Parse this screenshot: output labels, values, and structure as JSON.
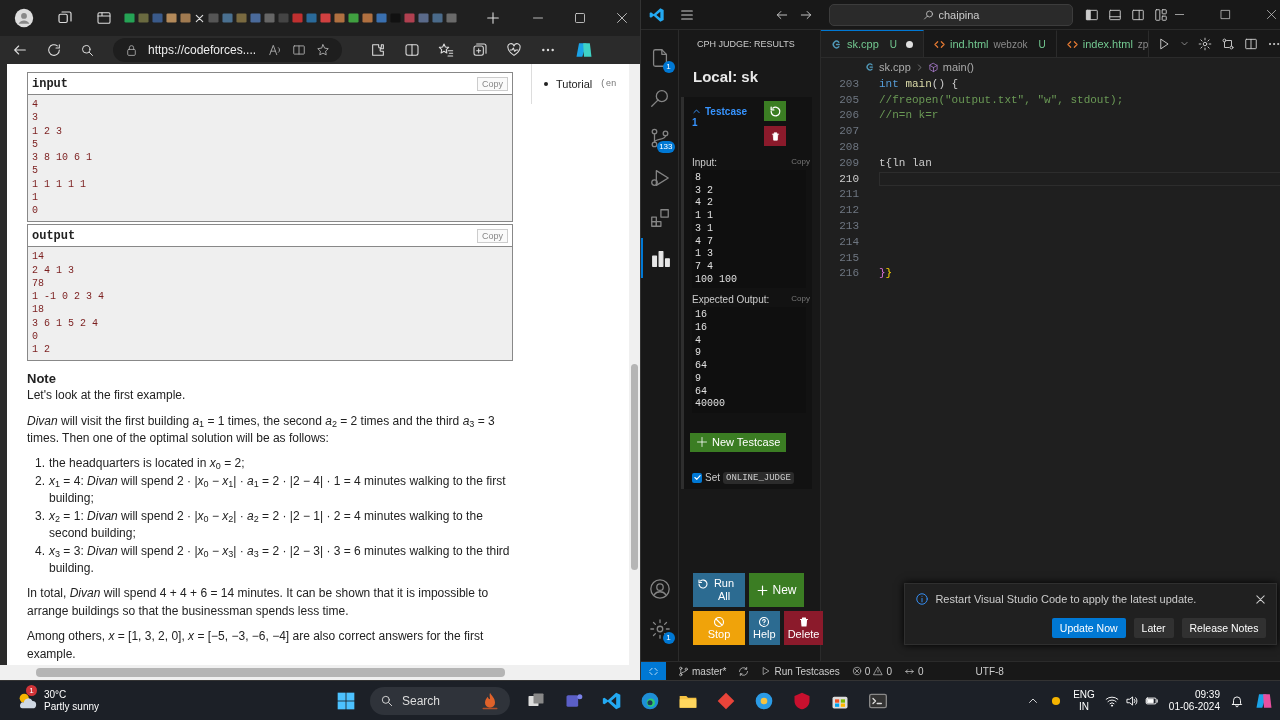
{
  "browser": {
    "address": "https://codeforces....",
    "examples": [
      {
        "title": "input",
        "copy": "Copy",
        "lines": [
          "4",
          "3",
          "1 2 3",
          "5",
          "3 8 10 6 1",
          "5",
          "1 1 1 1 1",
          "1",
          "0"
        ]
      },
      {
        "title": "output",
        "copy": "Copy",
        "lines": [
          "14",
          "2 4 1 3",
          "78",
          "1 -1 0 2 3 4",
          "18",
          "3 6 1 5 2 4",
          "0",
          "1 2"
        ]
      }
    ],
    "side_links": [
      {
        "label": "Tutorial",
        "note": "(en"
      }
    ],
    "note": {
      "title": "Note",
      "before": [
        "Let's look at the first example.",
        "*Divan* will visit the first building *a*$_{1}$ = 1 times, the second *a*$_{2}$ = 2 times and the third *a*$_{3}$ = 3 times. Then one of the optimal solution will be as follows:"
      ],
      "steps": [
        {
          "number": "1.",
          "text": "the headquarters is located in *x*$_{0}$ = 2;"
        },
        {
          "number": "2.",
          "text": "*x*$_{1}$ = 4: *Divan* will spend 2 · |*x*$_{0}$ − *x*$_{1}$| · *a*$_{1}$ = 2 · |2 − 4| · 1 = 4 minutes walking to the first building;"
        },
        {
          "number": "3.",
          "text": "*x*$_{2}$ = 1: *Divan* will spend 2 · |*x*$_{0}$ − *x*$_{2}$| · *a*$_{2}$ = 2 · |2 − 1| · 2 = 4 minutes walking to the second building;"
        },
        {
          "number": "4.",
          "text": "*x*$_{3}$ = 3: *Divan* will spend 2 · |*x*$_{0}$ − *x*$_{3}$| · *a*$_{3}$ = 2 · |2 − 3| · 3 = 6 minutes walking to the third building."
        }
      ],
      "after": [
        "In total, *Divan* will spend 4 + 4 + 6 = 14 minutes. It can be shown that it is impossible to arrange buildings so that the businessman spends less time.",
        "Among others, *x* = [1, 3, 2, 0], *x* = [−5, −3, −6, −4] are also correct answers for the first example."
      ]
    }
  },
  "vscode": {
    "search": "chaipina",
    "activity": [
      {
        "kind": "files",
        "selected": false,
        "badge": "1"
      },
      {
        "kind": "search",
        "selected": false
      },
      {
        "kind": "source-control",
        "selected": false,
        "badge": "133"
      },
      {
        "kind": "run",
        "selected": false
      },
      {
        "kind": "extensions",
        "selected": false
      },
      {
        "kind": "chart",
        "selected": true
      }
    ],
    "activity_bottom": [
      {
        "kind": "account"
      },
      {
        "kind": "settings",
        "badge": "1"
      }
    ],
    "cph": {
      "header": "CPH JUDGE: RESULTS",
      "title": "Local: sk",
      "testcase": {
        "label": "Testcase",
        "number": "1",
        "expanded": true,
        "input_label": "Input:",
        "input_copy": "Copy",
        "input": [
          "8",
          "3 2",
          "4 2",
          "1 1",
          "3 1",
          "4 7",
          "1 3",
          "7 4",
          "100 100"
        ],
        "expected_label": "Expected Output:",
        "expected_copy": "Copy",
        "expected": [
          "16",
          "16",
          "4",
          "9",
          "64",
          "9",
          "64",
          "40000"
        ]
      },
      "new_testcase": "New Testcase",
      "online_judge": {
        "label": "Set",
        "code": "ONLINE_JUDGE",
        "checked": true
      },
      "actions": [
        {
          "kind": "run-all",
          "label": "Run All"
        },
        {
          "kind": "new",
          "label": "New"
        },
        {
          "kind": "stop",
          "label": "Stop"
        },
        {
          "kind": "help",
          "label": "Help"
        },
        {
          "kind": "delete",
          "label": "Delete"
        }
      ]
    },
    "tabs": [
      {
        "kind": "cpp",
        "name": "sk.cpp",
        "status": "U",
        "modified": true,
        "selected": true
      },
      {
        "kind": "html",
        "name": "ind.html",
        "folder": "webzok",
        "status": "U",
        "modified": false,
        "selected": false
      },
      {
        "kind": "html",
        "name": "index.html",
        "folder": "zp",
        "modified": false,
        "selected": false
      }
    ],
    "breadcrumb": [
      "sk.cpp",
      "main()"
    ],
    "code": [
      {
        "number": "203",
        "current": false,
        "tokens": [
          {
            "kind": "keyword",
            "text": "int "
          },
          {
            "kind": "function",
            "text": "main"
          },
          {
            "kind": "plain",
            "text": "() {"
          }
        ]
      },
      {
        "number": "205",
        "current": false,
        "tokens": [
          {
            "kind": "comment",
            "text": "//freopen(\"output.txt\", \"w\", stdout);"
          }
        ]
      },
      {
        "number": "206",
        "current": false,
        "tokens": [
          {
            "kind": "comment",
            "text": "//n=n k=r"
          }
        ]
      },
      {
        "number": "207",
        "current": false
      },
      {
        "number": "208",
        "current": false
      },
      {
        "number": "209",
        "current": false,
        "tokens": [
          {
            "kind": "plain",
            "text": "t{ln lan"
          }
        ]
      },
      {
        "number": "210",
        "current": true
      },
      {
        "number": "211",
        "current": false
      },
      {
        "number": "212",
        "current": false
      },
      {
        "number": "213",
        "current": false
      },
      {
        "number": "214",
        "current": false
      },
      {
        "number": "215",
        "current": false
      },
      {
        "number": "216",
        "current": false,
        "tokens": [
          {
            "kind": "bracket2",
            "text": "}"
          },
          {
            "kind": "bracket",
            "text": "}"
          }
        ]
      }
    ],
    "notification": {
      "message": "Restart Visual Studio Code to apply the latest update.",
      "buttons": [
        {
          "kind": "primary",
          "label": "Update Now"
        },
        {
          "kind": "secondary",
          "label": "Later"
        },
        {
          "kind": "secondary",
          "label": "Release Notes"
        }
      ]
    },
    "status": {
      "branch": "master*",
      "run": "Run Testcases",
      "errors": "0",
      "warnings": "0",
      "ports": "0",
      "encoding": "UTF-8"
    }
  },
  "taskbar": {
    "temperature": "30°C",
    "weather": "Partly sunny",
    "weather_badge": "1",
    "search": "Search",
    "language": "ENG",
    "region": "IN",
    "time": "09:39",
    "date": "01-06-2024"
  }
}
